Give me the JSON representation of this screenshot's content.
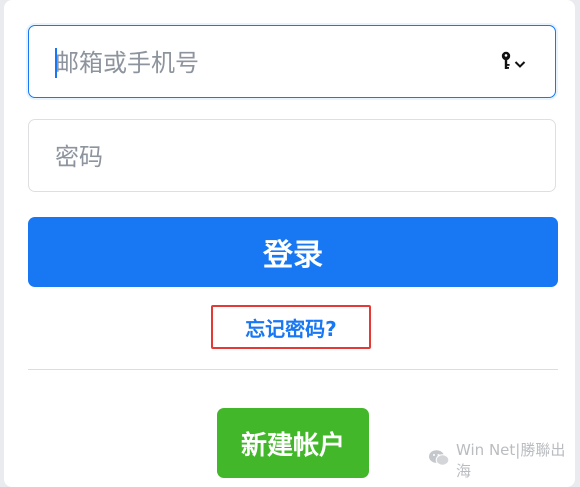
{
  "login_form": {
    "email_placeholder": "邮箱或手机号",
    "password_placeholder": "密码",
    "login_label": "登录",
    "forgot_label": "忘记密码?",
    "create_account_label": "新建帐户"
  },
  "watermark": {
    "text": "Win Net|勝聯出海"
  },
  "icons": {
    "password_manager": "key-icon",
    "dropdown": "chevron-down-icon",
    "watermark_logo": "wechat-icon"
  },
  "colors": {
    "primary": "#1877f2",
    "create": "#42b72a",
    "highlight_box": "#e53935"
  }
}
